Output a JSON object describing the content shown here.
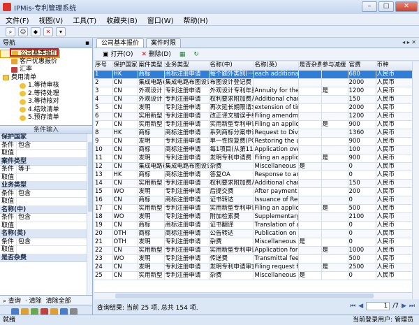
{
  "window": {
    "title": "IPMis-专利管理系统"
  },
  "menu": [
    "文件(F)",
    "视图(V)",
    "工具(T)",
    "收藏夹(B)",
    "窗口(W)",
    "帮助(H)"
  ],
  "nav": {
    "title": "导航",
    "items": [
      {
        "label": "公司基本报价",
        "level": 1,
        "icon": "v",
        "selected": true
      },
      {
        "label": "客户优惠报价",
        "level": 1,
        "icon": "g"
      },
      {
        "label": "汇率",
        "level": 1,
        "icon": "r"
      },
      {
        "label": "费用清单",
        "level": 0,
        "icon": "f"
      },
      {
        "label": "1.等待审核",
        "level": 2,
        "icon": "d"
      },
      {
        "label": "2.等待处理",
        "level": 2,
        "icon": "d"
      },
      {
        "label": "3.等待核对",
        "level": 2,
        "icon": "d"
      },
      {
        "label": "4.结效清单",
        "level": 2,
        "icon": "d"
      },
      {
        "label": "5.预存清单",
        "level": 2,
        "icon": "d"
      }
    ]
  },
  "conditions": {
    "title": "条件输入",
    "groups": [
      {
        "name": "保护国家",
        "rows": [
          [
            "条件",
            "包含"
          ],
          [
            "取值",
            ""
          ]
        ]
      },
      {
        "name": "案件类型",
        "rows": [
          [
            "条件",
            "等于"
          ],
          [
            "取值",
            ""
          ]
        ]
      },
      {
        "name": "业务类型",
        "rows": [
          [
            "条件",
            "包含"
          ],
          [
            "取值",
            ""
          ]
        ]
      },
      {
        "name": "名称(中)",
        "rows": [
          [
            "条件",
            "包含"
          ],
          [
            "取值",
            ""
          ]
        ]
      },
      {
        "name": "名称(英)",
        "rows": [
          [
            "条件",
            "包含"
          ],
          [
            "取值",
            ""
          ]
        ]
      },
      {
        "name": "是否杂费",
        "rows": []
      }
    ]
  },
  "query_bar": {
    "query": "查询",
    "clear": "清除",
    "clear_all": "清除全部"
  },
  "tabs": [
    {
      "label": "公司基本报价",
      "active": true
    },
    {
      "label": "案件时限",
      "active": false
    }
  ],
  "panel_toolbar": {
    "open": "打开(O)",
    "delete": "删除(D)"
  },
  "grid": {
    "columns": [
      "序号",
      "保护国家",
      "案件类型",
      "业务类型",
      "名称(中)",
      "名称(英)",
      "是否杂费",
      "参与减缓",
      "官费",
      "币种"
    ],
    "rows": [
      [
        "1",
        "HK",
        "商标",
        "商标注册申请",
        "每个额外类别(一类",
        "each additional",
        "",
        "",
        "680",
        "人民币"
      ],
      [
        "2",
        "CN",
        "集成电路布图",
        "集成电路布图设计",
        "布图设计登记费",
        "",
        "",
        "",
        "2000",
        "人民币"
      ],
      [
        "3",
        "CN",
        "外观设计",
        "专利注册申请",
        "外观设计专利年费",
        "Annuity for the y",
        "",
        "是",
        "1200",
        "人民币"
      ],
      [
        "4",
        "CN",
        "外观设计",
        "专利注册申请",
        "权利要求附加费从",
        "Additional charg",
        "",
        "",
        "150",
        "人民币"
      ],
      [
        "5",
        "CN",
        "发明",
        "专利注册申请",
        "再次延长期限请求",
        "extension of tim",
        "",
        "",
        "2000",
        "人民币"
      ],
      [
        "6",
        "CN",
        "实用新型",
        "专利注册申请",
        "改正译文错误手续",
        "Filing amendmen",
        "",
        "",
        "1200",
        "人民币"
      ],
      [
        "7",
        "CN",
        "实用新型",
        "专利注册申请",
        "实用新型专利申请",
        "Filing an applica",
        "",
        "是",
        "900",
        "人民币"
      ],
      [
        "8",
        "HK",
        "商标",
        "商标注册申请",
        "系列商标分案申请",
        "Request to Divid",
        "",
        "",
        "1360",
        "人民币"
      ],
      [
        "9",
        "CN",
        "发明",
        "专利注册申请",
        "单一性恢复费(PC",
        "Restoring the ur",
        "",
        "",
        "900",
        "人民币"
      ],
      [
        "10",
        "CN",
        "商标",
        "商标注册申请",
        "每1项目(从第11",
        "Application over",
        "",
        "",
        "100",
        "人民币"
      ],
      [
        "11",
        "CN",
        "发明",
        "专利注册申请",
        "发明专利申请费",
        "Filing an applica",
        "",
        "是",
        "900",
        "人民币"
      ],
      [
        "12",
        "CN",
        "集成电路布图",
        "集成电路布图设计",
        "杂费",
        "Miscellaneous D",
        "是",
        "",
        "0",
        "人民币"
      ],
      [
        "13",
        "HK",
        "商标",
        "商标注册申请",
        "答复OA",
        "Response to an",
        "",
        "",
        "0",
        "人民币"
      ],
      [
        "14",
        "CN",
        "实用新型",
        "专利注册申请",
        "权利要求附加费从",
        "Additional charg",
        "",
        "",
        "150",
        "人民币"
      ],
      [
        "15",
        "WO",
        "发明",
        "专利注册申请",
        "后提交费",
        "After payment",
        "",
        "",
        "200",
        "人民币"
      ],
      [
        "16",
        "CN",
        "商标",
        "商标注册申请",
        "证书转达",
        "Issuance of Reg",
        "",
        "",
        "0",
        "人民币"
      ],
      [
        "17",
        "CN",
        "实用新型",
        "专利注册申请",
        "实用新型专利申请",
        "Filing an applica",
        "",
        "是",
        "500",
        "人民币"
      ],
      [
        "18",
        "WO",
        "发明",
        "专利注册申请",
        "附加检索费",
        "Supplementary s",
        "",
        "",
        "2100",
        "人民币"
      ],
      [
        "19",
        "CN",
        "商标",
        "商标注册申请",
        "证书翻译",
        "Translation of ar",
        "",
        "",
        "0",
        "人民币"
      ],
      [
        "20",
        "OTH",
        "商标",
        "商标注册申请",
        "公告转达",
        "Publication on G",
        "",
        "",
        "0",
        "人民币"
      ],
      [
        "21",
        "OTH",
        "发明",
        "专利注册申请",
        "杂费",
        "Miscellaneous D",
        "是",
        "",
        "0",
        "人民币"
      ],
      [
        "22",
        "CN",
        "实用新型",
        "专利注册申请",
        "实用新型专利申请",
        "Application for f",
        "",
        "是",
        "1000",
        "人民币"
      ],
      [
        "23",
        "WO",
        "发明",
        "专利注册申请",
        "传送费",
        "Transmittal fee",
        "",
        "",
        "500",
        "人民币"
      ],
      [
        "24",
        "CN",
        "发明",
        "专利注册申请",
        "发明专利申请审查",
        "Filing request fo",
        "",
        "是",
        "2500",
        "人民币"
      ],
      [
        "25",
        "CN",
        "实用新型",
        "专利注册申请",
        "杂费",
        "Miscellaneous D",
        "是",
        "",
        "0",
        "人民币"
      ]
    ]
  },
  "footer": {
    "result": "查询结果: 当前 25 项, 总共 154 项.",
    "page": "1",
    "total_pages": "/7"
  },
  "status": {
    "left": "就绪",
    "right": "当前登录用户: 管理员"
  }
}
